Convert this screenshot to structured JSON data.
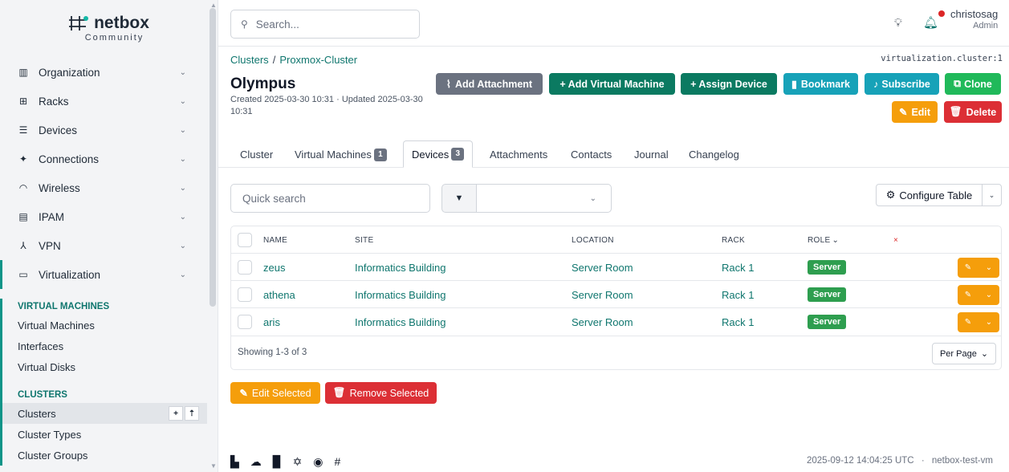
{
  "app": {
    "logo": "netbox",
    "logo_sub": "Community"
  },
  "sidebar": {
    "menu": [
      {
        "label": "Organization",
        "icon": "org-icon"
      },
      {
        "label": "Racks",
        "icon": "rack-icon"
      },
      {
        "label": "Devices",
        "icon": "server-icon"
      },
      {
        "label": "Connections",
        "icon": "plug-icon"
      },
      {
        "label": "Wireless",
        "icon": "wifi-icon"
      },
      {
        "label": "IPAM",
        "icon": "ipam-icon"
      },
      {
        "label": "VPN",
        "icon": "vpn-icon"
      },
      {
        "label": "Virtualization",
        "icon": "monitor-icon"
      }
    ],
    "sections": [
      {
        "title": "VIRTUAL MACHINES",
        "items": [
          "Virtual Machines",
          "Interfaces",
          "Virtual Disks"
        ]
      },
      {
        "title": "CLUSTERS",
        "items": [
          "Clusters",
          "Cluster Types",
          "Cluster Groups"
        ]
      }
    ],
    "active_item": "Clusters"
  },
  "topbar": {
    "search_placeholder": "Search...",
    "username": "christosag",
    "role": "Admin"
  },
  "page": {
    "breadcrumb": [
      "Clusters",
      "Proxmox-Cluster"
    ],
    "object_id": "virtualization.cluster:1",
    "title": "Olympus",
    "meta": "Created 2025-03-30 10:31 · Updated 2025-03-30 10:31",
    "buttons": {
      "add_attachment": "Add Attachment",
      "add_vm": "+ Add Virtual Machine",
      "assign_device": "+ Assign Device",
      "bookmark": "Bookmark",
      "subscribe": "Subscribe",
      "clone": "Clone",
      "edit": "Edit",
      "delete": "Delete"
    }
  },
  "tabs": [
    {
      "label": "Cluster",
      "badge": ""
    },
    {
      "label": "Virtual Machines",
      "badge": "1"
    },
    {
      "label": "Devices",
      "badge": "3"
    },
    {
      "label": "Attachments",
      "badge": ""
    },
    {
      "label": "Contacts",
      "badge": ""
    },
    {
      "label": "Journal",
      "badge": ""
    },
    {
      "label": "Changelog",
      "badge": ""
    }
  ],
  "filters": {
    "quick_search_placeholder": "Quick search",
    "configure_table": "Configure Table"
  },
  "table": {
    "columns": [
      "NAME",
      "SITE",
      "LOCATION",
      "RACK",
      "ROLE"
    ],
    "rows": [
      {
        "name": "zeus",
        "site": "Informatics Building",
        "location": "Server Room",
        "rack": "Rack 1",
        "role": "Server"
      },
      {
        "name": "athena",
        "site": "Informatics Building",
        "location": "Server Room",
        "rack": "Rack 1",
        "role": "Server"
      },
      {
        "name": "aris",
        "site": "Informatics Building",
        "location": "Server Room",
        "rack": "Rack 1",
        "role": "Server"
      }
    ],
    "showing": "Showing 1-3 of 3",
    "per_page": "Per Page"
  },
  "bulk": {
    "edit_selected": "Edit Selected",
    "remove_selected": "Remove Selected"
  },
  "footer": {
    "timestamp": "2025-09-12 14:04:25 UTC",
    "separator": "·",
    "host": "netbox-test-vm"
  }
}
